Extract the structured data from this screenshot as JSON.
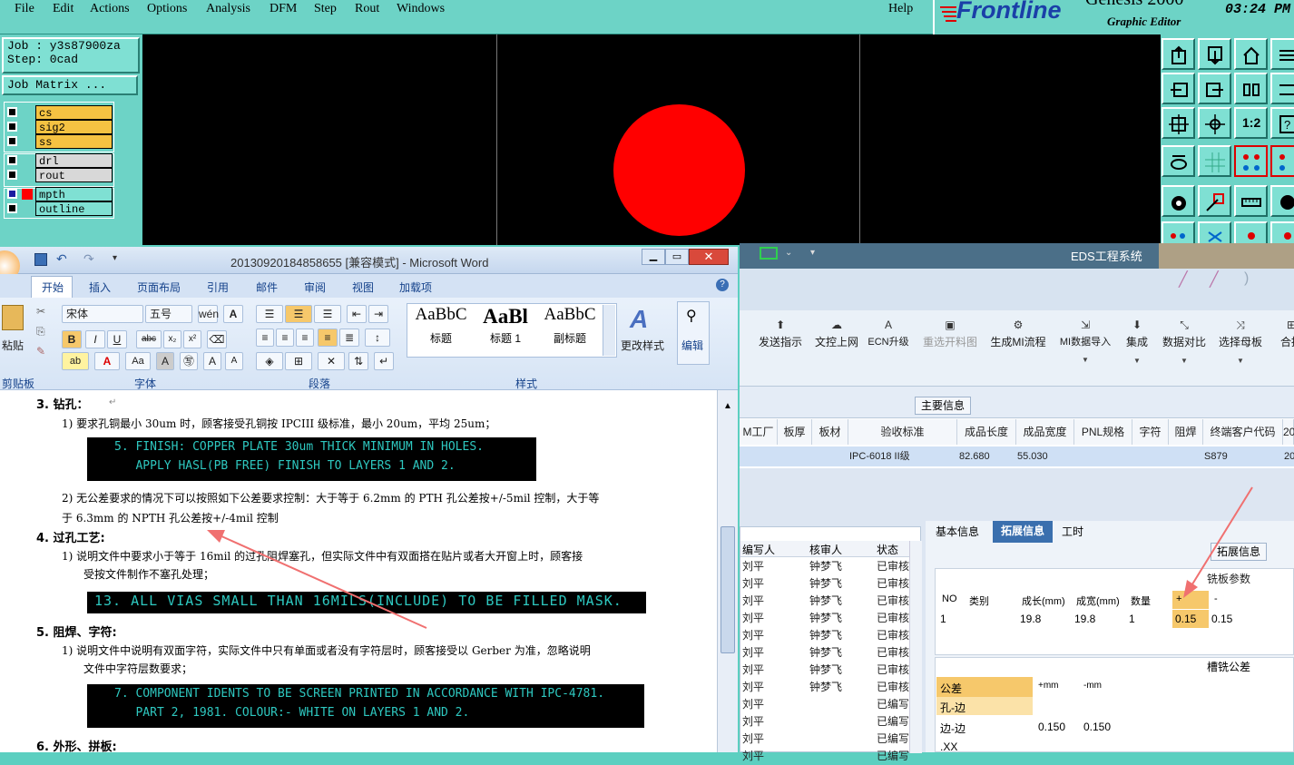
{
  "genesis": {
    "menu": [
      "File",
      "Edit",
      "Actions",
      "Options",
      "Analysis",
      "DFM",
      "Step",
      "Rout",
      "Windows"
    ],
    "help": "Help",
    "brand": "Frontline",
    "product": "Genesis 2000",
    "subtitle": "Graphic Editor",
    "time": "03:24 PM",
    "job": "Job : y3s87900za",
    "step": "Step: 0cad",
    "job_matrix": "Job Matrix ...",
    "layers": [
      {
        "name": "cs",
        "color": "#f5c242"
      },
      {
        "name": "sig2",
        "color": "#f5c242"
      },
      {
        "name": "ss",
        "color": "#f5c242"
      },
      {
        "name": "drl",
        "color": "#d8d8d8"
      },
      {
        "name": "rout",
        "color": "#d8d8d8"
      },
      {
        "name": "mpth",
        "color": "#7fe0d3"
      },
      {
        "name": "outline",
        "color": "#7fe0d3"
      }
    ],
    "circle_color": "#ff0000",
    "tool_12": "1:2"
  },
  "eds": {
    "title": "EDS工程系统",
    "tools": [
      "发送指示",
      "文控上网",
      "ECN升级",
      "重选开料图",
      "生成MI流程",
      "MI数据导入",
      "集成",
      "数据对比",
      "选择母板",
      "合拼"
    ],
    "main_info_tab": "主要信息",
    "table": {
      "headers": [
        "M工厂",
        "板厚",
        "板材",
        "验收标准",
        "成品长度",
        "成品宽度",
        "PNL规格",
        "字符",
        "阻焊",
        "终端客户代码",
        "20"
      ],
      "row": [
        "",
        "",
        "",
        "IPC-6018 II级",
        "82.680",
        "55.030",
        "",
        "",
        "",
        "S879",
        "20"
      ]
    },
    "staff": {
      "headers": [
        "编写人",
        "核审人",
        "状态"
      ],
      "rows": [
        [
          "刘平",
          "钟梦飞",
          "已审核"
        ],
        [
          "刘平",
          "钟梦飞",
          "已审核"
        ],
        [
          "刘平",
          "钟梦飞",
          "已审核"
        ],
        [
          "刘平",
          "钟梦飞",
          "已审核"
        ],
        [
          "刘平",
          "钟梦飞",
          "已审核"
        ],
        [
          "刘平",
          "钟梦飞",
          "已审核"
        ],
        [
          "刘平",
          "钟梦飞",
          "已审核"
        ],
        [
          "刘平",
          "钟梦飞",
          "已审核"
        ],
        [
          "刘平",
          "",
          "已编写"
        ],
        [
          "刘平",
          "",
          "已编写"
        ],
        [
          "刘平",
          "",
          "已编写"
        ],
        [
          "刘平",
          "",
          "已编写"
        ]
      ]
    },
    "tabs": [
      "基本信息",
      "拓展信息",
      "工时"
    ],
    "ext_btn": "拓展信息",
    "mill": {
      "title": "铣板参数",
      "headers": [
        "NO",
        "类别",
        "成长(mm)",
        "成宽(mm)",
        "数量",
        "+",
        "-"
      ],
      "row": [
        "1",
        "",
        "19.8",
        "19.8",
        "1",
        "0.15",
        "0.15"
      ]
    },
    "slot": {
      "title": "槽铣公差",
      "headers": [
        "公差",
        "+mm",
        "-mm"
      ],
      "rows": [
        [
          "孔-边",
          "",
          ""
        ],
        [
          "边-边",
          "0.150",
          "0.150"
        ],
        [
          ".XX",
          "",
          ""
        ]
      ]
    }
  },
  "word": {
    "title": "20130920184858655 [兼容模式] - Microsoft Word",
    "tabs": [
      "开始",
      "插入",
      "页面布局",
      "引用",
      "邮件",
      "审阅",
      "视图",
      "加载项"
    ],
    "font_name": "宋体",
    "font_size": "五号",
    "paste": "粘贴",
    "groups": [
      "剪贴板",
      "字体",
      "段落",
      "样式"
    ],
    "styles": [
      {
        "sample": "AaBbC",
        "name": "标题"
      },
      {
        "sample": "AaBl",
        "name": "标题 1"
      },
      {
        "sample": "AaBbC",
        "name": "副标题"
      }
    ],
    "change_style": "更改样式",
    "edit": "编辑",
    "doc": {
      "h3": "3.   钻孔：",
      "p1": "1)  要求孔铜最小 30um 时，顾客接受孔铜按 IPCIII 级标准，最小 20um，平均 25um；",
      "blk1": "5. FINISH: COPPER PLATE 30um THICK MINIMUM IN HOLES.\n   APPLY HASL(PB FREE) FINISH TO LAYERS 1 AND 2.",
      "p2a": "2) 无公差要求的情况下可以按照如下公差要求控制：大于等于 6.2mm 的 PTH 孔公差按+/-5mil 控制，大于等",
      "p2b": "于 6.3mm 的 NPTH 孔公差按+/-4mil 控制",
      "h4": "4.   过孔工艺:",
      "p3a": "1)  说明文件中要求小于等于 16mil 的过孔阻焊塞孔，但实际文件中有双面搭在贴片或者大开窗上时，顾客接",
      "p3b": "受按文件制作不塞孔处理；",
      "blk2": "13. ALL VIAS SMALL THAN 16MILS(INCLUDE) TO BE FILLED MASK.",
      "h5": "5.   阻焊、字符:",
      "p4a": "1)  说明文件中说明有双面字符，实际文件中只有单面或者没有字符层时，顾客接受以 Gerber 为准，忽略说明",
      "p4b": "文件中字符层数要求；",
      "blk3": "7. COMPONENT IDENTS TO BE SCREEN PRINTED IN ACCORDANCE WITH IPC-4781.\n   PART 2, 1981. COLOUR:- WHITE ON LAYERS 1 AND 2.",
      "h6": "6.   外形、拼板:"
    }
  }
}
